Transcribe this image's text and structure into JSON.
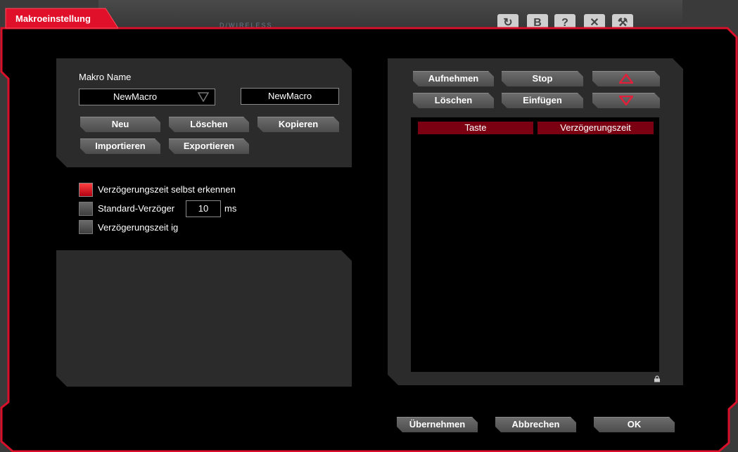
{
  "background_app": {
    "brand": "D/WIRELESS",
    "toolbar_icons": [
      "refresh-icon",
      "b-icon",
      "help-icon",
      "close-icon",
      "settings-icon"
    ]
  },
  "dialog": {
    "title": "Makroeinstellung"
  },
  "macro": {
    "name_label": "Makro Name",
    "selected": "NewMacro",
    "name_value": "NewMacro",
    "buttons": {
      "new": "Neu",
      "delete": "Löschen",
      "copy": "Kopieren",
      "import": "Importieren",
      "export": "Exportieren"
    }
  },
  "delay": {
    "auto_detect": {
      "label": "Verzögerungszeit selbst erkennen",
      "checked": true
    },
    "standard": {
      "label": "Standard-Verzöger",
      "checked": false,
      "value": "10",
      "unit": "ms"
    },
    "ignore": {
      "label": "Verzögerungszeit ig",
      "checked": false
    }
  },
  "recorder": {
    "record": "Aufnehmen",
    "stop": "Stop",
    "delete": "Löschen",
    "insert": "Einfügen",
    "accent": "#d8203a",
    "columns": [
      "Taste",
      "Verzögerungszeit"
    ]
  },
  "footer": {
    "apply": "Übernehmen",
    "cancel": "Abbrechen",
    "ok": "OK"
  },
  "colors": {
    "accent_red": "#e0102a",
    "header_red": "#7a0012"
  }
}
